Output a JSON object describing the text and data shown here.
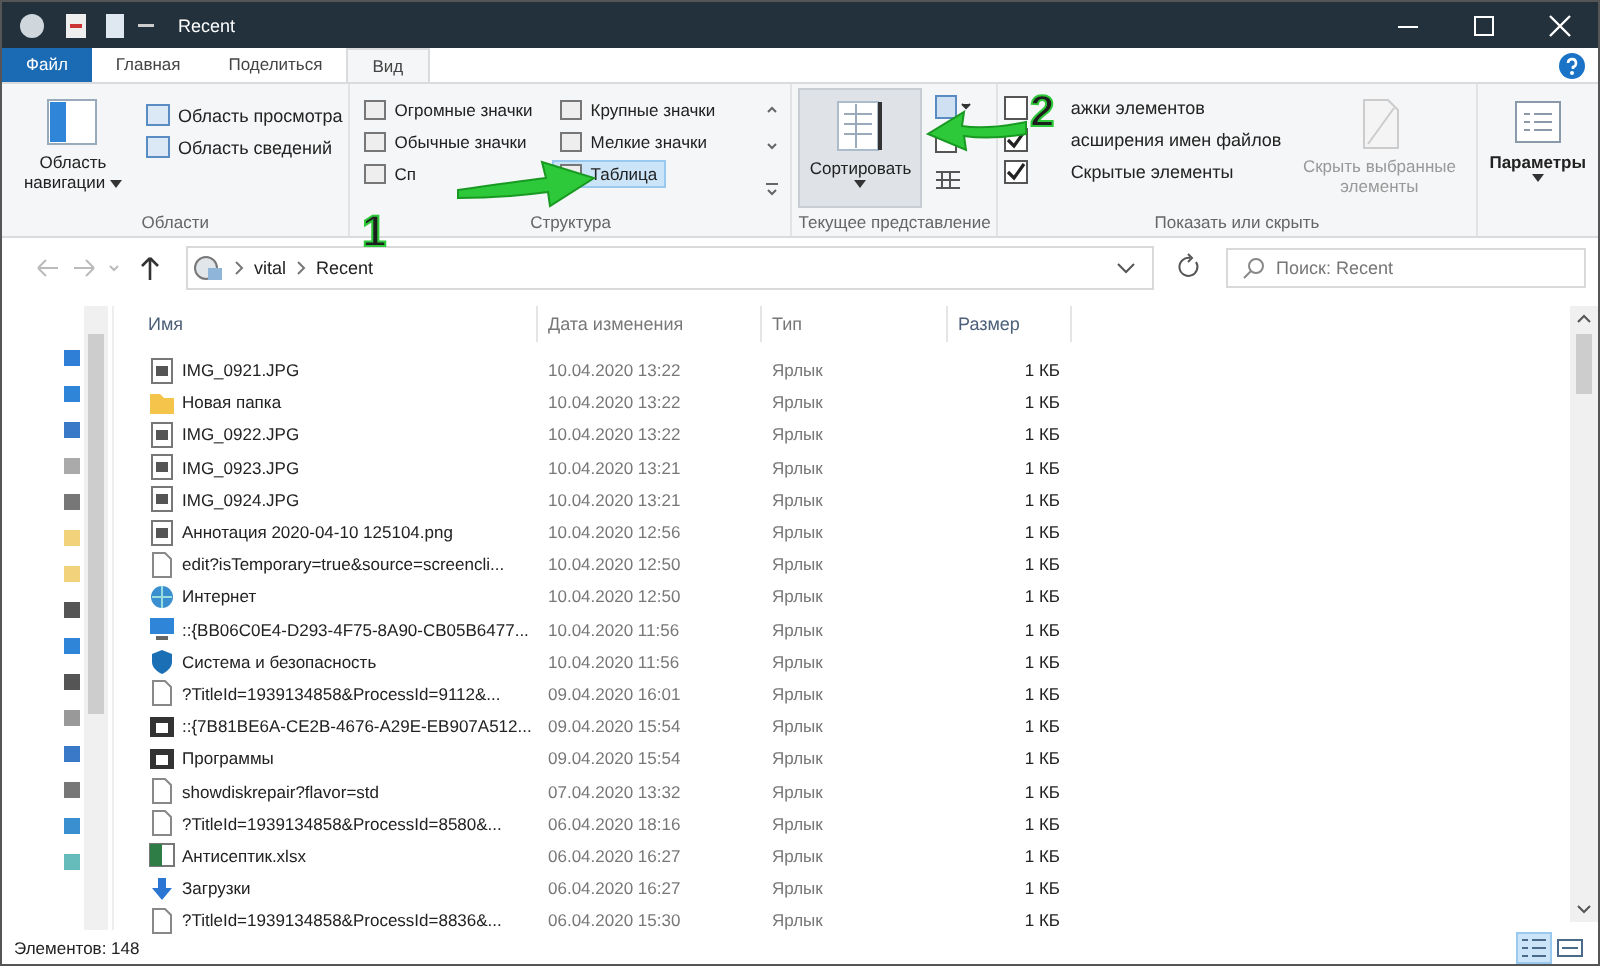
{
  "window": {
    "title": "Recent"
  },
  "ribbon_tabs": [
    {
      "label": "Файл",
      "kind": "file",
      "selected": false
    },
    {
      "label": "Главная",
      "kind": "tab",
      "selected": false
    },
    {
      "label": "Поделиться",
      "kind": "tab",
      "selected": false
    },
    {
      "label": "Вид",
      "kind": "tab",
      "selected": true
    }
  ],
  "ribbon": {
    "areas": {
      "label": "Области",
      "navigation_pane": "Область навигации",
      "preview_pane": "Область просмотра",
      "details_pane": "Область сведений"
    },
    "layout": {
      "label": "Структура",
      "options": [
        {
          "label": "Огромные значки",
          "selected": false
        },
        {
          "label": "Крупные значки",
          "selected": false
        },
        {
          "label": "Обычные значки",
          "selected": false
        },
        {
          "label": "Мелкие значки",
          "selected": false
        },
        {
          "label": "Сп",
          "selected": false
        },
        {
          "label": "Таблица",
          "selected": true
        }
      ]
    },
    "current_view": {
      "label": "Текущее представление",
      "sort_button": "Сортировать"
    },
    "show_hide": {
      "label": "Показать или скрыть",
      "checkboxes": [
        {
          "label": "ажки элементов",
          "checked": false
        },
        {
          "label": "асширения имен файлов",
          "checked": true
        },
        {
          "label": "Скрытые элементы",
          "checked": true
        }
      ],
      "hide_selected": {
        "label": "Скрыть выбранные элементы",
        "disabled": true
      }
    },
    "options_button": "Параметры"
  },
  "address_bar": {
    "path": [
      "vital",
      "Recent"
    ],
    "search": {
      "placeholder": "Поиск: Recent"
    }
  },
  "table": {
    "columns": [
      "Имя",
      "Дата изменения",
      "Тип",
      "Размер"
    ],
    "rows": [
      {
        "name": "IMG_0921.JPG",
        "kind": "image",
        "date": "10.04.2020 13:22",
        "type": "Ярлык",
        "size": "1 КБ"
      },
      {
        "name": "Новая папка",
        "kind": "folder",
        "date": "10.04.2020 13:22",
        "type": "Ярлык",
        "size": "1 КБ"
      },
      {
        "name": "IMG_0922.JPG",
        "kind": "image",
        "date": "10.04.2020 13:22",
        "type": "Ярлык",
        "size": "1 КБ"
      },
      {
        "name": "IMG_0923.JPG",
        "kind": "image",
        "date": "10.04.2020 13:21",
        "type": "Ярлык",
        "size": "1 КБ"
      },
      {
        "name": "IMG_0924.JPG",
        "kind": "image",
        "date": "10.04.2020 13:21",
        "type": "Ярлык",
        "size": "1 КБ"
      },
      {
        "name": "Аннотация 2020-04-10 125104.png",
        "kind": "image",
        "date": "10.04.2020 12:56",
        "type": "Ярлык",
        "size": "1 КБ"
      },
      {
        "name": "edit?isTemporary=true&source=screencli...",
        "kind": "file",
        "date": "10.04.2020 12:50",
        "type": "Ярлык",
        "size": "1 КБ"
      },
      {
        "name": "Интернет",
        "kind": "network",
        "date": "10.04.2020 12:50",
        "type": "Ярлык",
        "size": "1 КБ"
      },
      {
        "name": "::{BB06C0E4-D293-4F75-8A90-CB05B6477...",
        "kind": "monitor",
        "date": "10.04.2020 11:56",
        "type": "Ярлык",
        "size": "1 КБ"
      },
      {
        "name": "Система и безопасность",
        "kind": "shield",
        "date": "10.04.2020 11:56",
        "type": "Ярлык",
        "size": "1 КБ"
      },
      {
        "name": "?TitleId=1939134858&ProcessId=9112&...",
        "kind": "file",
        "date": "09.04.2020 16:01",
        "type": "Ярлык",
        "size": "1 КБ"
      },
      {
        "name": "::{7B81BE6A-CE2B-4676-A29E-EB907A512...",
        "kind": "app",
        "date": "09.04.2020 15:54",
        "type": "Ярлык",
        "size": "1 КБ"
      },
      {
        "name": "Программы",
        "kind": "app",
        "date": "09.04.2020 15:54",
        "type": "Ярлык",
        "size": "1 КБ"
      },
      {
        "name": "showdiskrepair?flavor=std",
        "kind": "file",
        "date": "07.04.2020 13:32",
        "type": "Ярлык",
        "size": "1 КБ"
      },
      {
        "name": "?TitleId=1939134858&ProcessId=8580&...",
        "kind": "file",
        "date": "06.04.2020 18:16",
        "type": "Ярлык",
        "size": "1 КБ"
      },
      {
        "name": "Антисептик.xlsx",
        "kind": "excel",
        "date": "06.04.2020 16:27",
        "type": "Ярлык",
        "size": "1 КБ"
      },
      {
        "name": "Загрузки",
        "kind": "download",
        "date": "06.04.2020 16:27",
        "type": "Ярлык",
        "size": "1 КБ"
      },
      {
        "name": "?TitleId=1939134858&ProcessId=8836&...",
        "kind": "file",
        "date": "06.04.2020 15:30",
        "type": "Ярлык",
        "size": "1 КБ"
      }
    ]
  },
  "status_bar": {
    "count": "Элементов: 148"
  },
  "annotations": [
    {
      "label": "1"
    },
    {
      "label": "2"
    }
  ]
}
